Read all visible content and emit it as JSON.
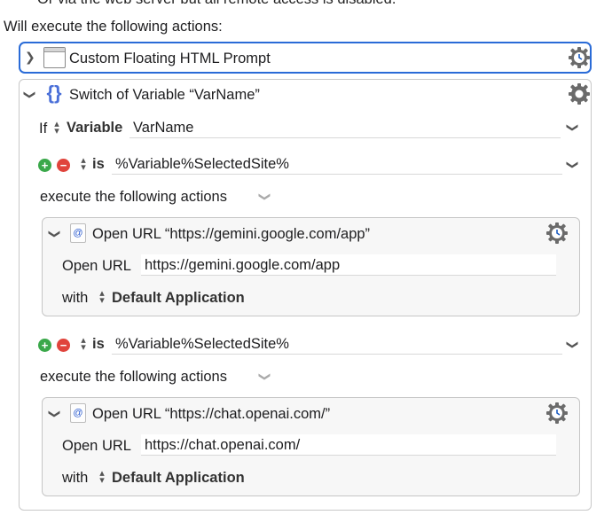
{
  "header": {
    "cut_text": "Or via the web server but all remote access is disabled.",
    "will_execute": "Will execute the following actions:"
  },
  "action_prompt": {
    "title": "Custom Floating HTML Prompt"
  },
  "switch_action": {
    "title": "Switch of Variable “VarName”",
    "if_label": "If",
    "source_label": "Variable",
    "variable_value": "VarName",
    "cases": [
      {
        "is_label": "is",
        "value": "%Variable%SelectedSite%",
        "execute_label": "execute the following actions",
        "action": {
          "title": "Open URL “https://gemini.google.com/app”",
          "open_url_label": "Open URL",
          "url": "https://gemini.google.com/app",
          "with_label": "with",
          "app": "Default Application"
        }
      },
      {
        "is_label": "is",
        "value": "%Variable%SelectedSite%",
        "execute_label": "execute the following actions",
        "action": {
          "title": "Open URL “https://chat.openai.com/”",
          "open_url_label": "Open URL",
          "url": "https://chat.openai.com/",
          "with_label": "with",
          "app": "Default Application"
        }
      }
    ]
  },
  "icons": {
    "gear": "gear-icon",
    "gear_clock": "gear-clock-icon",
    "url": "url-at-icon",
    "window": "window-icon",
    "switch": "switch-braces-icon"
  },
  "colors": {
    "focus_border": "#2a6bd7",
    "add_button": "#3aa84a",
    "remove_button": "#e0443c"
  }
}
